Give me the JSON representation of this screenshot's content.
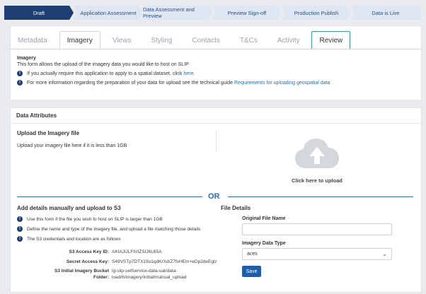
{
  "steps": [
    {
      "label": "Draft",
      "active": true
    },
    {
      "label": "Application Assessment",
      "active": false
    },
    {
      "label": "Data Assessment and Preview",
      "active": false
    },
    {
      "label": "Preview Sign-off",
      "active": false
    },
    {
      "label": "Production Publish",
      "active": false
    },
    {
      "label": "Data is Live",
      "active": false
    }
  ],
  "tabs": [
    "Metadata",
    "Imagery",
    "Views",
    "Styling",
    "Contacts",
    "T&Cs",
    "Activity",
    "Review"
  ],
  "intro": {
    "title": "Imagery",
    "description": "This form allows the upload of the imagery data you would like to host on SLIP",
    "info1_text": "If you actually require this application to apply to a spatial dataset, click",
    "info1_link": "here.",
    "info2_text": "For more information regarding the preparation of your data for upload see the technical guide",
    "info2_link": "Requirements for uploading geospatial data"
  },
  "card": {
    "title": "Data Attributes",
    "upload_title": "Upload the Imagery file",
    "upload_desc": "Upload your imagery file here if it is less than 1GB",
    "click_upload": "Click here to upload",
    "or": "OR",
    "s3_title": "Add details manually and upload to S3",
    "s3_items": [
      "Use this form if the file you wish to host on SLIP is larger than 1GB",
      "Define the name and type of the imagery file, and upload a file matching those details",
      "The S3 credentials and location are as follows"
    ],
    "access_key_label": "S3 Access Key ID:",
    "access_key_value": "AKIAJULFIVIZSIJ6L65A",
    "secret_key_label": "Secret Access Key:",
    "secret_key_value": "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",
    "bucket_label_1": "S3 Initial Imagery Bucket",
    "bucket_label_2": "Folder:",
    "bucket_value_1": "lg-slip-selfservice-data-uat/data-",
    "bucket_value_2": "load/6/imagery/initial/manual_upload",
    "file_details_title": "File Details",
    "original_file_label": "Original File Name",
    "original_file_value": "",
    "imagery_type_label": "Imagery Data Type",
    "imagery_type_value": "aces",
    "save_label": "Save"
  }
}
